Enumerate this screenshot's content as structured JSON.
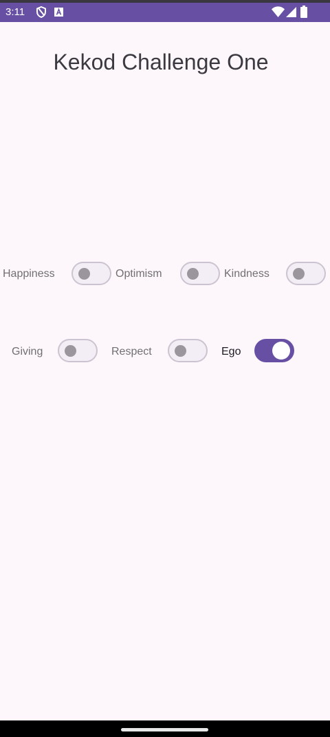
{
  "status_bar": {
    "time": "3:11",
    "icons": [
      "shield-icon",
      "a-icon",
      "wifi-icon",
      "cellular-icon",
      "battery-icon"
    ],
    "color": "#6750a4"
  },
  "app": {
    "title": "Kekod Challenge One"
  },
  "switches": [
    {
      "label": "Happiness",
      "on": false
    },
    {
      "label": "Optimism",
      "on": false
    },
    {
      "label": "Kindness",
      "on": false
    },
    {
      "label": "Giving",
      "on": false
    },
    {
      "label": "Respect",
      "on": false
    },
    {
      "label": "Ego",
      "on": true
    }
  ],
  "colors": {
    "accent": "#6750a4",
    "background": "#fdf7fc"
  }
}
